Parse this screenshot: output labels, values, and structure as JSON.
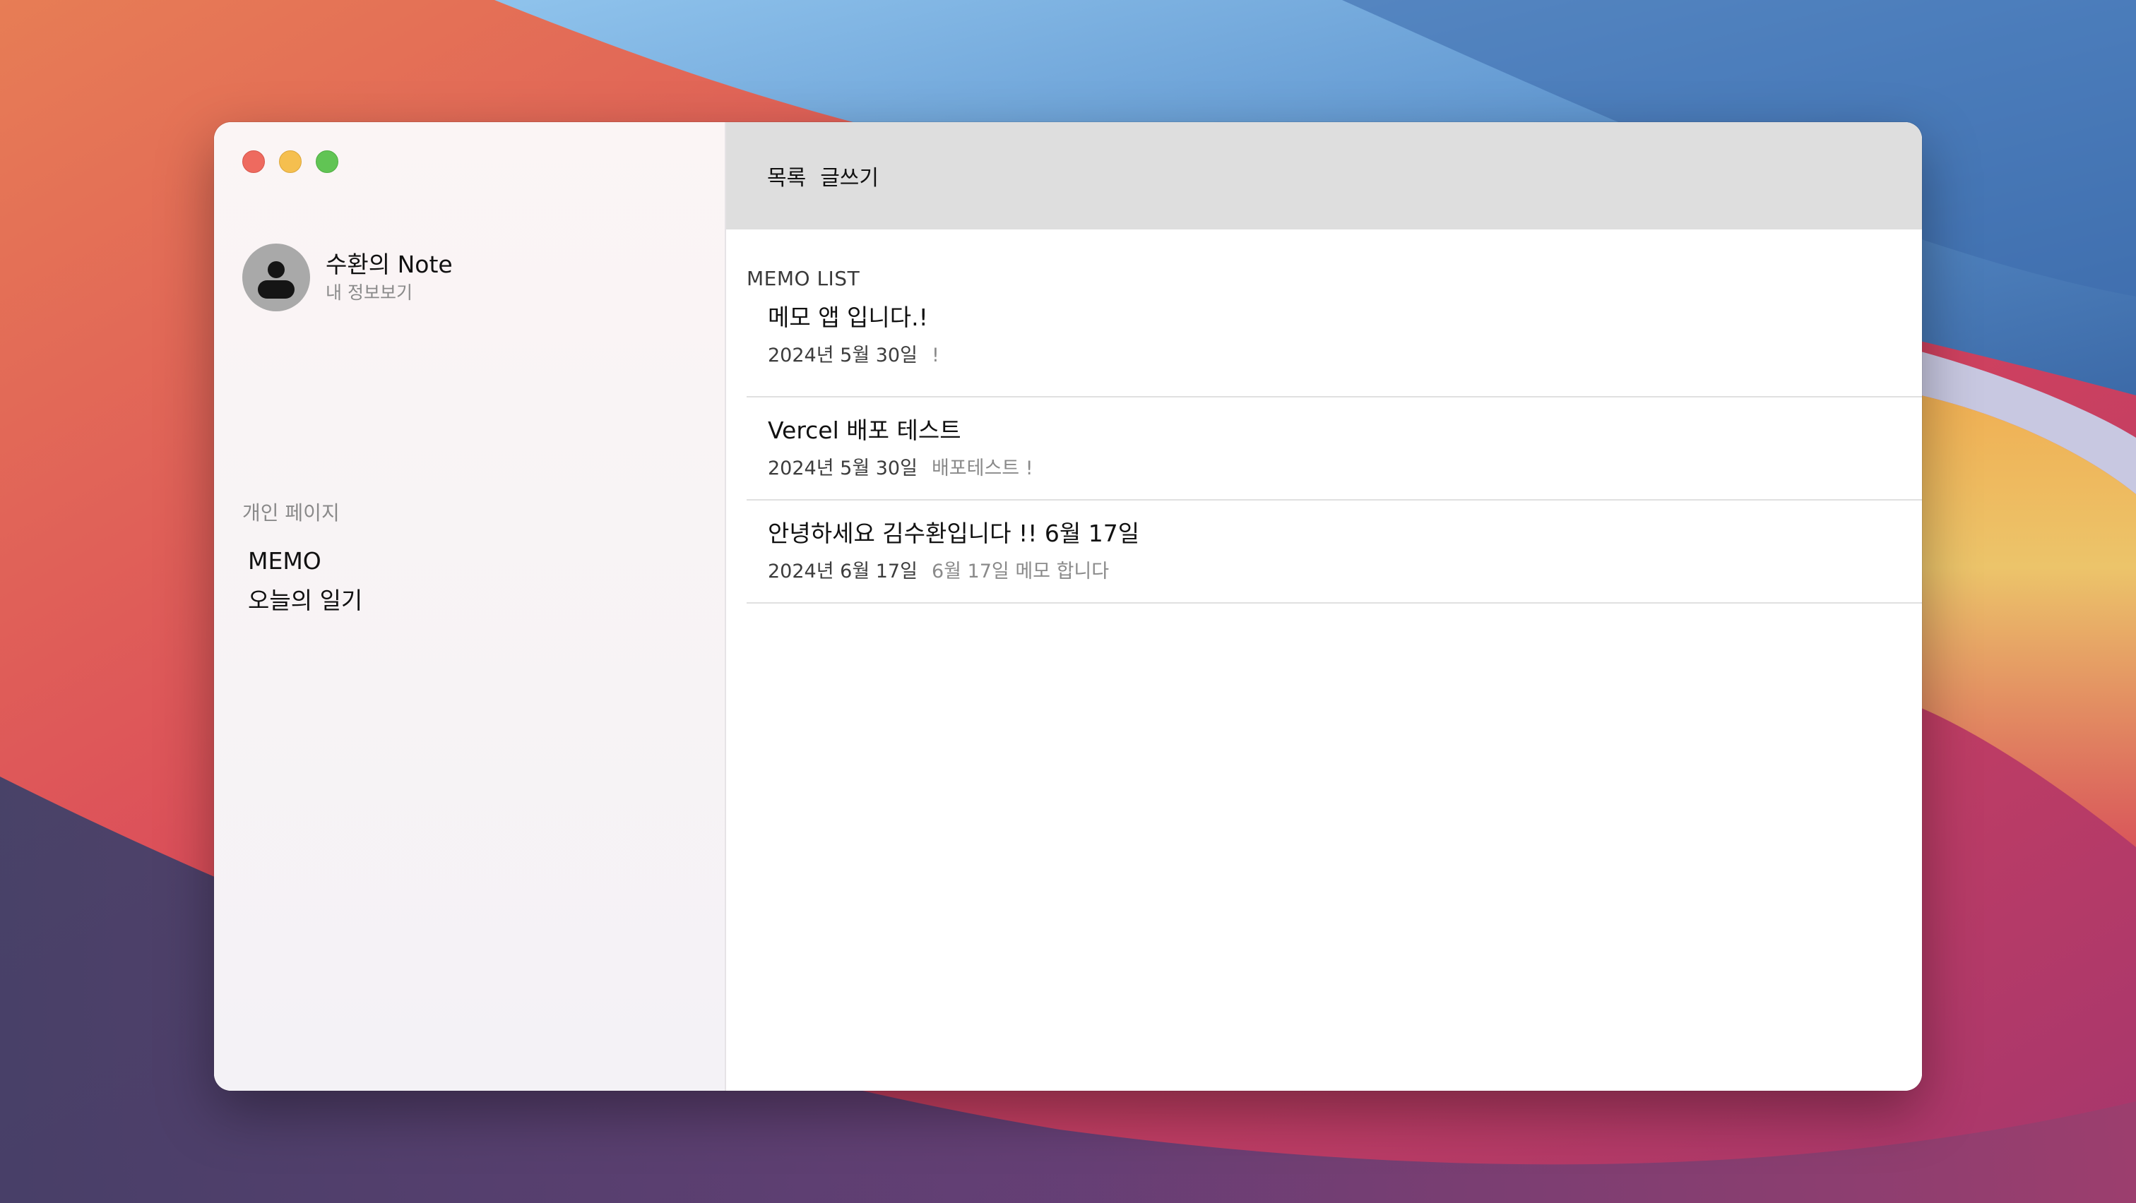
{
  "sidebar": {
    "profile": {
      "name": "수환의 Note",
      "link": "내 정보보기"
    },
    "section_label": "개인 페이지",
    "items": [
      {
        "label": "MEMO"
      },
      {
        "label": "오늘의 일기"
      }
    ]
  },
  "topbar": {
    "tabs": [
      {
        "label": "목록"
      },
      {
        "label": "글쓰기"
      }
    ]
  },
  "memo_list": {
    "title": "MEMO LIST",
    "items": [
      {
        "title": "메모 앱 입니다.!",
        "date": "2024년 5월 30일",
        "body": "!"
      },
      {
        "title": "Vercel 배포 테스트",
        "date": "2024년 5월 30일",
        "body": "배포테스트 !"
      },
      {
        "title": "안녕하세요 김수환입니다 !! 6월 17일",
        "date": "2024년 6월 17일",
        "body": "6월 17일 메모 합니다"
      }
    ]
  },
  "colors": {
    "close": "#ee6a5f",
    "minimize": "#f5bf4f",
    "zoom": "#61c454",
    "topbar": "#dedede",
    "avatar": "#a9a9a9"
  },
  "icons": {
    "avatar": "person-icon"
  }
}
